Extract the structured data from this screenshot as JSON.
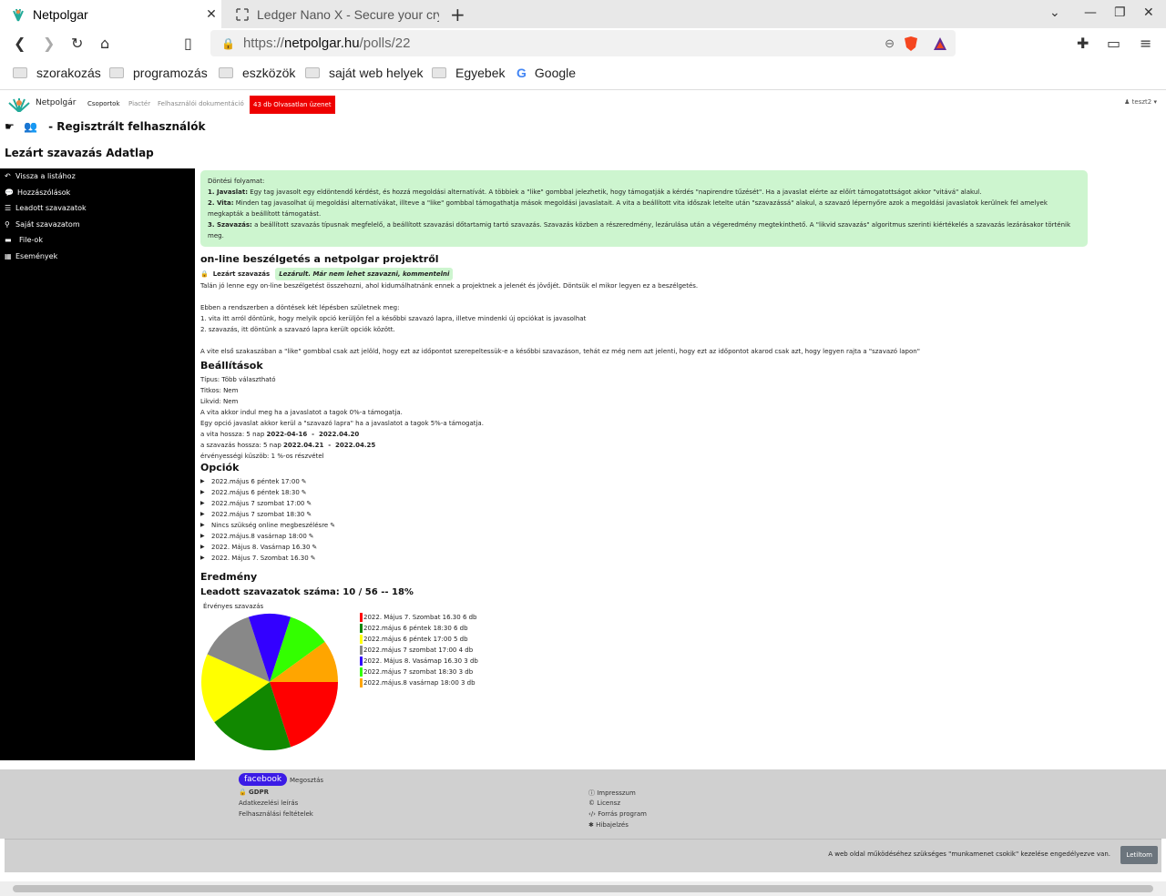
{
  "browser": {
    "tabs": [
      {
        "title": "Netpolgar",
        "active": true
      },
      {
        "title": "Ledger Nano X - Secure your crypto",
        "active": false
      }
    ],
    "url": {
      "proto": "https://",
      "host": "netpolgar.hu",
      "path": "/polls/22"
    },
    "bookmarks": [
      "szorakozás",
      "programozás",
      "eszközök",
      "saját web helyek",
      "Egyebek",
      "Google"
    ]
  },
  "site": {
    "brand": "Netpolgár",
    "nav": [
      "Csoportok",
      "Piactér",
      "Felhasználói dokumentáció"
    ],
    "unread": "43 db Olvasatlan üzenet",
    "user": "teszt2",
    "group_title": "- Regisztrált felhasználók",
    "page_title": "Lezárt szavazás Adatlap",
    "sidebar": [
      "Vissza a listához",
      "Hozzászólások",
      "Leadott szavazatok",
      "Saját szavazatom",
      "File-ok",
      "Események"
    ]
  },
  "info": {
    "heading": "Döntési folyamat:",
    "step1_label": "1. Javaslat:",
    "step1": "Egy tag javasolt egy eldöntendő kérdést, és hozzá megoldási alternatívát. A többiek a \"like\" gombbal jelezhetik, hogy támogatják a kérdés \"napirendre tűzését\". Ha a javaslat elérte az előírt támogatottságot akkor \"vitává\" alakul.",
    "step2_label": "2. Vita:",
    "step2": "Minden tag javasolhat új megoldási alternatívákat, illteve a \"like\" gombbal támogathatja mások megoldási javaslatait. A vita a beállított vita időszak letelte után \"szavazássá\" alakul, a szavazó lépernyőre azok a megoldási javaslatok kerülnek fel amelyek megkapták a beállított támogatást.",
    "step3_label": "3. Szavazás:",
    "step3": "a beállított szavazás típusnak megfelelő, a beállított szavazási dőtartamig tartó szavazás. Szavazás közben a részeredmény, lezárulása után a végeredmény megtekinthető. A \"likvid szavazás\" algoritmus szerinti kiértékelés a szavazás lezárásakor történik meg."
  },
  "poll": {
    "title": "on-line beszélgetés a netpolgar projektről",
    "status": "Lezárt szavazás",
    "closed_note": "Lezárult. Már nem lehet szavazni, kommentelni",
    "desc1": "Talán jó lenne egy on-line beszélgetést összehozni, ahol kidumálhatnánk ennek a projektnek a jelenét és jövőjét. Döntsük el mikor legyen ez a beszélgetés.",
    "desc2": "Ebben a rendszerben a döntések két lépésben születnek meg:",
    "desc3": "1. vita itt arról döntünk, hogy melyik opció kerüljön fel a későbbi szavazó lapra, illetve mindenki új opciókat is javasolhat",
    "desc4": "2. szavazás, itt döntünk a szavazó lapra került opciók között.",
    "desc5": "A vite első szakaszában a \"like\" gombbal csak azt jelöld, hogy ezt az időpontot szerepeltessük-e a későbbi szavazáson, tehát ez még nem azt jelenti, hogy ezt az időpontot akarod csak azt, hogy legyen rajta a \"szavazó lapon\""
  },
  "settings": {
    "heading": "Beállítások",
    "type": "Típus: Több választható",
    "secret": "Titkos: Nem",
    "liquid": "Likvid: Nem",
    "debate_start": "A vita akkor indul meg ha a javaslatot a tagok 0%-a támogatja.",
    "option_rule": "Egy opció javaslat akkor kerül a \"szavazó lapra\" ha a javaslatot a tagok 5%-a támogatja.",
    "debate_len_prefix": "a vita hossza: 5 nap",
    "debate_dates": "2022-04-16  -  2022.04.20",
    "vote_len_prefix": "a szavazás hossza: 5 nap",
    "vote_dates": "2022.04.21  -  2022.04.25",
    "threshold": "érvényességi küszöb: 1 %-os részvétel"
  },
  "options": {
    "heading": "Opciók",
    "items": [
      "2022.május 6 péntek 17:00",
      "2022.május 6 péntek 18:30",
      "2022.május 7 szombat 17:00",
      "2022.május 7 szombat 18:30",
      "Nincs szükség online megbeszélésre",
      "2022.május.8 vasárnap 18:00",
      "2022. Május 8. Vasárnap 16.30",
      "2022. Május 7. Szombat 16.30"
    ]
  },
  "result": {
    "heading": "Eredmény",
    "count": "Leadott szavazatok száma: 10 / 56 -- 18%",
    "chart_title": "Érvényes szavazás"
  },
  "chart_data": {
    "type": "pie",
    "title": "Érvényes szavazás",
    "categories": [
      "2022. Május 7. Szombat 16.30",
      "2022.május 6 péntek 18:30",
      "2022.május 6 péntek 17:00",
      "2022.május 7 szombat 17:00",
      "2022. Május 8. Vasámap 16.30",
      "2022.május 7 szombat 18:30",
      "2022.május.8 vasárnap 18:00"
    ],
    "values": [
      6,
      6,
      5,
      4,
      3,
      3,
      3
    ],
    "labels": [
      "2022. Május 7. Szombat 16.30 6 db",
      "2022.május 6 péntek 18:30 6 db",
      "2022.május 6 péntek 17:00 5 db",
      "2022.május 7 szombat 17:00 4 db",
      "2022. Május 8. Vasámap 16.30 3 db",
      "2022.május 7 szombat 18:30 3 db",
      "2022.május.8 vasárnap 18:00 3 db"
    ],
    "colors": [
      "#ff0000",
      "#118800",
      "#ffff00",
      "#888888",
      "#3300ff",
      "#33ff00",
      "#ffa500"
    ],
    "legend": "right"
  },
  "footer": {
    "facebook": "facebook",
    "share": "Megosztás",
    "gdpr": "GDPR",
    "privacy": "Adatkezelési leírás",
    "terms": "Felhasználási feltételek",
    "impressum": "Impresszum",
    "license": "Licensz",
    "source": "Forrás program",
    "bug": "Hibajelzés"
  },
  "cookie": {
    "message": "A web oldal működéséhez szükséges \"munkamenet csokik\" kezelése engedélyezve van.",
    "button": "Letiltom"
  }
}
